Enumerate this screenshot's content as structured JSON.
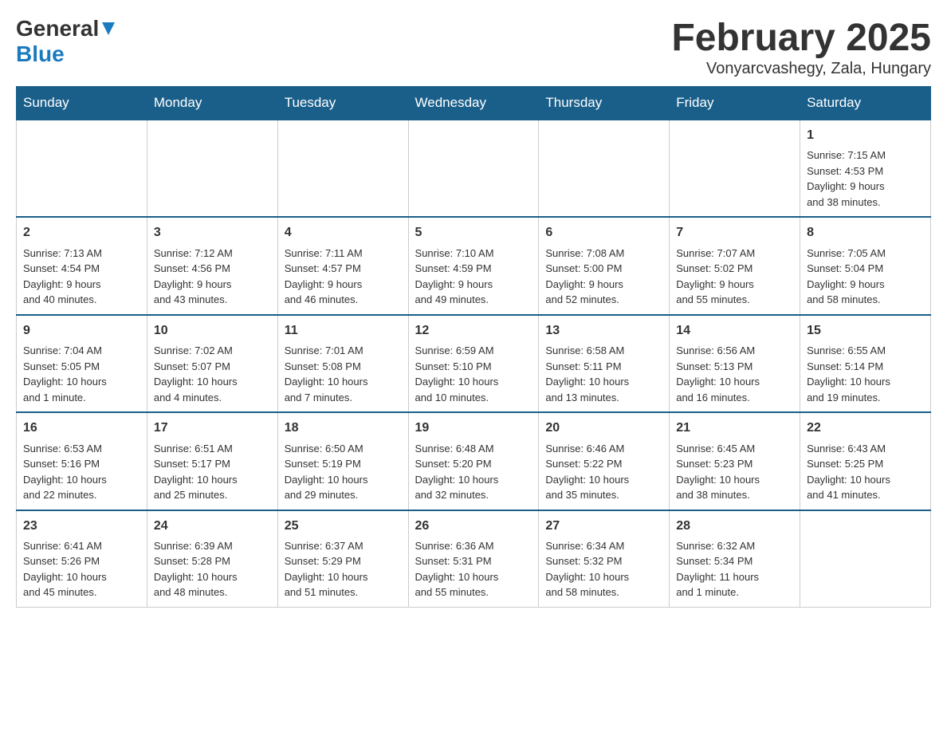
{
  "header": {
    "logo_general": "General",
    "logo_blue": "Blue",
    "month_title": "February 2025",
    "location": "Vonyarcvashegy, Zala, Hungary"
  },
  "weekdays": [
    "Sunday",
    "Monday",
    "Tuesday",
    "Wednesday",
    "Thursday",
    "Friday",
    "Saturday"
  ],
  "weeks": [
    [
      {
        "day": "",
        "info": ""
      },
      {
        "day": "",
        "info": ""
      },
      {
        "day": "",
        "info": ""
      },
      {
        "day": "",
        "info": ""
      },
      {
        "day": "",
        "info": ""
      },
      {
        "day": "",
        "info": ""
      },
      {
        "day": "1",
        "info": "Sunrise: 7:15 AM\nSunset: 4:53 PM\nDaylight: 9 hours\nand 38 minutes."
      }
    ],
    [
      {
        "day": "2",
        "info": "Sunrise: 7:13 AM\nSunset: 4:54 PM\nDaylight: 9 hours\nand 40 minutes."
      },
      {
        "day": "3",
        "info": "Sunrise: 7:12 AM\nSunset: 4:56 PM\nDaylight: 9 hours\nand 43 minutes."
      },
      {
        "day": "4",
        "info": "Sunrise: 7:11 AM\nSunset: 4:57 PM\nDaylight: 9 hours\nand 46 minutes."
      },
      {
        "day": "5",
        "info": "Sunrise: 7:10 AM\nSunset: 4:59 PM\nDaylight: 9 hours\nand 49 minutes."
      },
      {
        "day": "6",
        "info": "Sunrise: 7:08 AM\nSunset: 5:00 PM\nDaylight: 9 hours\nand 52 minutes."
      },
      {
        "day": "7",
        "info": "Sunrise: 7:07 AM\nSunset: 5:02 PM\nDaylight: 9 hours\nand 55 minutes."
      },
      {
        "day": "8",
        "info": "Sunrise: 7:05 AM\nSunset: 5:04 PM\nDaylight: 9 hours\nand 58 minutes."
      }
    ],
    [
      {
        "day": "9",
        "info": "Sunrise: 7:04 AM\nSunset: 5:05 PM\nDaylight: 10 hours\nand 1 minute."
      },
      {
        "day": "10",
        "info": "Sunrise: 7:02 AM\nSunset: 5:07 PM\nDaylight: 10 hours\nand 4 minutes."
      },
      {
        "day": "11",
        "info": "Sunrise: 7:01 AM\nSunset: 5:08 PM\nDaylight: 10 hours\nand 7 minutes."
      },
      {
        "day": "12",
        "info": "Sunrise: 6:59 AM\nSunset: 5:10 PM\nDaylight: 10 hours\nand 10 minutes."
      },
      {
        "day": "13",
        "info": "Sunrise: 6:58 AM\nSunset: 5:11 PM\nDaylight: 10 hours\nand 13 minutes."
      },
      {
        "day": "14",
        "info": "Sunrise: 6:56 AM\nSunset: 5:13 PM\nDaylight: 10 hours\nand 16 minutes."
      },
      {
        "day": "15",
        "info": "Sunrise: 6:55 AM\nSunset: 5:14 PM\nDaylight: 10 hours\nand 19 minutes."
      }
    ],
    [
      {
        "day": "16",
        "info": "Sunrise: 6:53 AM\nSunset: 5:16 PM\nDaylight: 10 hours\nand 22 minutes."
      },
      {
        "day": "17",
        "info": "Sunrise: 6:51 AM\nSunset: 5:17 PM\nDaylight: 10 hours\nand 25 minutes."
      },
      {
        "day": "18",
        "info": "Sunrise: 6:50 AM\nSunset: 5:19 PM\nDaylight: 10 hours\nand 29 minutes."
      },
      {
        "day": "19",
        "info": "Sunrise: 6:48 AM\nSunset: 5:20 PM\nDaylight: 10 hours\nand 32 minutes."
      },
      {
        "day": "20",
        "info": "Sunrise: 6:46 AM\nSunset: 5:22 PM\nDaylight: 10 hours\nand 35 minutes."
      },
      {
        "day": "21",
        "info": "Sunrise: 6:45 AM\nSunset: 5:23 PM\nDaylight: 10 hours\nand 38 minutes."
      },
      {
        "day": "22",
        "info": "Sunrise: 6:43 AM\nSunset: 5:25 PM\nDaylight: 10 hours\nand 41 minutes."
      }
    ],
    [
      {
        "day": "23",
        "info": "Sunrise: 6:41 AM\nSunset: 5:26 PM\nDaylight: 10 hours\nand 45 minutes."
      },
      {
        "day": "24",
        "info": "Sunrise: 6:39 AM\nSunset: 5:28 PM\nDaylight: 10 hours\nand 48 minutes."
      },
      {
        "day": "25",
        "info": "Sunrise: 6:37 AM\nSunset: 5:29 PM\nDaylight: 10 hours\nand 51 minutes."
      },
      {
        "day": "26",
        "info": "Sunrise: 6:36 AM\nSunset: 5:31 PM\nDaylight: 10 hours\nand 55 minutes."
      },
      {
        "day": "27",
        "info": "Sunrise: 6:34 AM\nSunset: 5:32 PM\nDaylight: 10 hours\nand 58 minutes."
      },
      {
        "day": "28",
        "info": "Sunrise: 6:32 AM\nSunset: 5:34 PM\nDaylight: 11 hours\nand 1 minute."
      },
      {
        "day": "",
        "info": ""
      }
    ]
  ]
}
